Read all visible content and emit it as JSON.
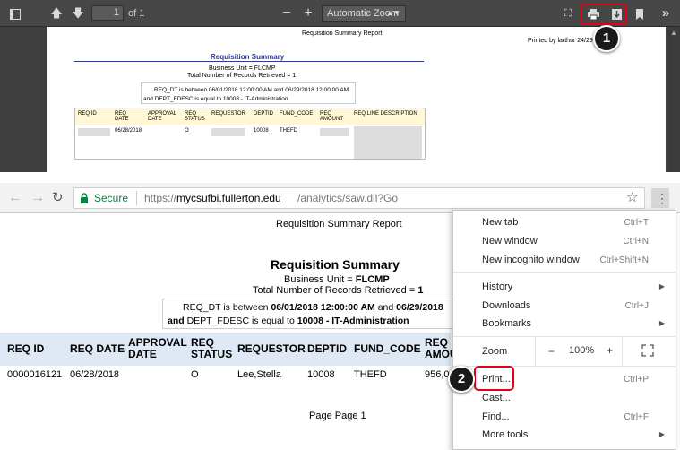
{
  "pdf_viewer": {
    "page_number": "1",
    "page_of": "of 1",
    "zoom": "Automatic Zoom",
    "report_title": "Requisition Summary Report",
    "printed_by": "Printed by larthur 24/29",
    "summary_title": "Requisition Summary",
    "business_unit": "Business Unit = FLCMP",
    "total_records": "Total Number of Records Retrieved = 1",
    "filter1": "REQ_DT is between 06/01/2018 12:00:00 AM and 06/29/2018 12:00:00 AM",
    "filter2": "and DEPT_FDESC is equal to 10008 - IT-Administration",
    "columns": [
      "REQ ID",
      "REQ DATE",
      "APPROVAL DATE",
      "REQ STATUS",
      "REQUESTOR",
      "DEPTID",
      "FUND_CODE",
      "REQ AMOUNT",
      "REQ LINE DESCRIPTION"
    ],
    "row": [
      "",
      "06/28/2018",
      "",
      "O",
      "",
      "10008",
      "THEFD",
      "",
      ""
    ]
  },
  "badges": {
    "step1": "1",
    "step2": "2"
  },
  "browser": {
    "secure_label": "Secure",
    "url_prefix": "https://",
    "url_host": "mycsufbi.fullerton.edu",
    "url_path": "/analytics/saw.dll?Go"
  },
  "report": {
    "title": "Requisition Summary Report",
    "summary_title": "Requisition Summary",
    "business_unit_label": "Business Unit = ",
    "business_unit_value": "FLCMP",
    "records_label": "Total Number of Records Retrieved = ",
    "records_value": "1",
    "f1_a": "REQ_DT is between ",
    "f1_b": "06/01/2018 12:00:00 AM",
    "f1_c": " and ",
    "f1_d": "06/29/2018",
    "f2_a": "and ",
    "f2_b": "DEPT_FDESC is equal to ",
    "f2_c": "10008 - IT-Administration",
    "columns": [
      "REQ ID",
      "REQ DATE",
      "APPROVAL DATE",
      "REQ STATUS",
      "REQUESTOR",
      "DEPTID",
      "FUND_CODE",
      "REQ AMOU"
    ],
    "row": [
      "0000016121",
      "06/28/2018",
      "",
      "O",
      "Lee,Stella",
      "10008",
      "THEFD",
      "956,0"
    ],
    "footer": "Page Page 1"
  },
  "menu": {
    "items": [
      {
        "label": "New tab",
        "shortcut": "Ctrl+T"
      },
      {
        "label": "New window",
        "shortcut": "Ctrl+N"
      },
      {
        "label": "New incognito window",
        "shortcut": "Ctrl+Shift+N"
      },
      {
        "label": "History",
        "shortcut": ""
      },
      {
        "label": "Downloads",
        "shortcut": "Ctrl+J"
      },
      {
        "label": "Bookmarks",
        "shortcut": ""
      },
      {
        "label": "Zoom",
        "shortcut": ""
      },
      {
        "label": "Print...",
        "shortcut": "Ctrl+P"
      },
      {
        "label": "Cast...",
        "shortcut": ""
      },
      {
        "label": "Find...",
        "shortcut": "Ctrl+F"
      },
      {
        "label": "More tools",
        "shortcut": ""
      }
    ],
    "zoom_minus": "−",
    "zoom_value": "100%",
    "zoom_plus": "+"
  }
}
